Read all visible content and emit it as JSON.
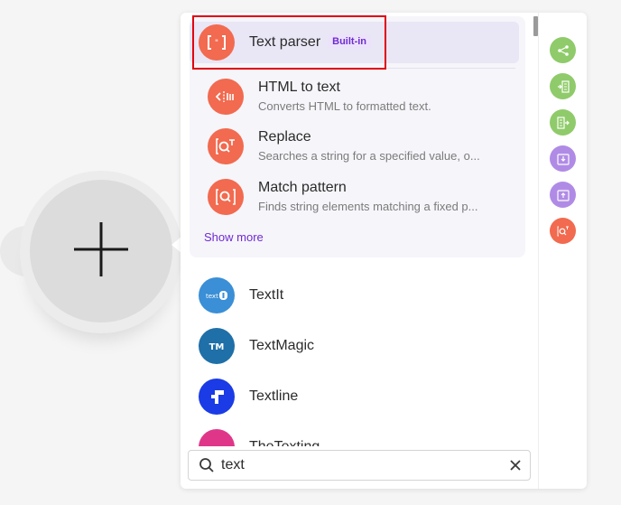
{
  "canvas": {
    "add_module_icon": "plus-icon"
  },
  "builtin_items": [
    {
      "title": "Text parser",
      "badge": "Built-in",
      "description": "",
      "icon": "text-parser-icon",
      "color": "#f26a4f"
    },
    {
      "title": "HTML to text",
      "description": "Converts HTML to formatted text.",
      "icon": "html-to-text-icon",
      "color": "#f26a4f"
    },
    {
      "title": "Replace",
      "description": "Searches a string for a specified value, o...",
      "icon": "replace-icon",
      "color": "#f26a4f"
    },
    {
      "title": "Match pattern",
      "description": "Finds string elements matching a fixed p...",
      "icon": "match-pattern-icon",
      "color": "#f26a4f"
    }
  ],
  "show_more_label": "Show more",
  "apps": [
    {
      "name": "TextIt",
      "icon": "textit-logo-icon",
      "color": "#3a8fd6"
    },
    {
      "name": "TextMagic",
      "icon": "textmagic-logo-icon",
      "color": "#1f6fa8"
    },
    {
      "name": "Textline",
      "icon": "textline-logo-icon",
      "color": "#1a3be6"
    },
    {
      "name": "TheTexting",
      "icon": "thetexting-logo-icon",
      "color": "#e0368a"
    }
  ],
  "search": {
    "value": "text",
    "icon": "search-icon",
    "clear_icon": "close-icon"
  },
  "right_rail": [
    {
      "icon": "share-icon",
      "color": "#8fcb6a"
    },
    {
      "icon": "import-list-icon",
      "color": "#8fcb6a"
    },
    {
      "icon": "export-list-icon",
      "color": "#8fcb6a"
    },
    {
      "icon": "download-box-icon",
      "color": "#b08be6"
    },
    {
      "icon": "upload-box-icon",
      "color": "#b08be6"
    },
    {
      "icon": "search-text-icon",
      "color": "#f26a4f"
    }
  ]
}
